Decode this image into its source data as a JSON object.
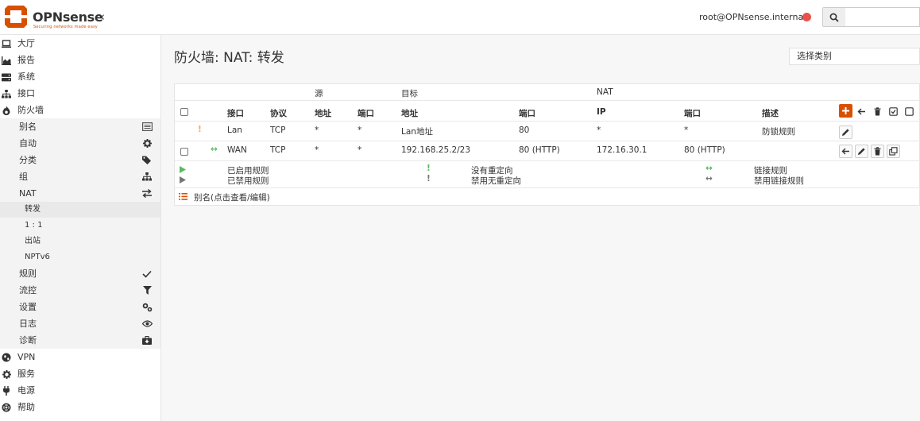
{
  "brand": {
    "name": "OPNsense",
    "tagline": "Securing networks made easy"
  },
  "header": {
    "user": "root@OPNsense.internal",
    "search_placeholder": ""
  },
  "sidebar": {
    "items": [
      {
        "label": "大厅",
        "icon": "laptop-icon"
      },
      {
        "label": "报告",
        "icon": "area-chart-icon"
      },
      {
        "label": "系统",
        "icon": "server-icon"
      },
      {
        "label": "接口",
        "icon": "sitemap-icon"
      },
      {
        "label": "防火墙",
        "icon": "fire-icon"
      }
    ],
    "firewall_sub": [
      {
        "label": "别名",
        "icon": "list-alt-icon"
      },
      {
        "label": "自动",
        "icon": "cog-icon"
      },
      {
        "label": "分类",
        "icon": "tags-icon"
      },
      {
        "label": "组",
        "icon": "sitemap-icon"
      },
      {
        "label": "NAT",
        "icon": "exchange-icon"
      }
    ],
    "nat_sub": [
      {
        "label": "转发"
      },
      {
        "label": "1 : 1"
      },
      {
        "label": "出站"
      },
      {
        "label": "NPTv6"
      }
    ],
    "firewall_sub2": [
      {
        "label": "规则",
        "icon": "check-icon"
      },
      {
        "label": "流控",
        "icon": "filter-icon"
      },
      {
        "label": "设置",
        "icon": "cogs-icon"
      },
      {
        "label": "日志",
        "icon": "eye-icon"
      },
      {
        "label": "诊断",
        "icon": "medkit-icon"
      }
    ],
    "bottom": [
      {
        "label": "VPN",
        "icon": "globe-icon"
      },
      {
        "label": "服务",
        "icon": "cog-icon"
      },
      {
        "label": "电源",
        "icon": "plug-icon"
      },
      {
        "label": "帮助",
        "icon": "support-icon"
      }
    ]
  },
  "page": {
    "title": "防火墙: NAT: 转发",
    "category_placeholder": "选择类别"
  },
  "table": {
    "group_headers": {
      "source": "源",
      "destination": "目标",
      "nat": "NAT"
    },
    "columns": {
      "interface": "接口",
      "protocol": "协议",
      "src_addr": "地址",
      "src_port": "端口",
      "dst_addr": "地址",
      "dst_port": "端口",
      "nat_ip": "IP",
      "nat_port": "端口",
      "description": "描述"
    },
    "rows": [
      {
        "interface": "Lan",
        "protocol": "TCP",
        "src_addr": "*",
        "src_port": "*",
        "dst_addr": "Lan地址",
        "dst_port": "80",
        "nat_ip": "*",
        "nat_port": "*",
        "description": "防锁规则"
      },
      {
        "interface": "WAN",
        "protocol": "TCP",
        "src_addr": "*",
        "src_port": "*",
        "dst_addr": "192.168.25.2/23",
        "dst_port": "80 (HTTP)",
        "nat_ip": "172.16.30.1",
        "nat_port": "80 (HTTP)",
        "description": ""
      }
    ]
  },
  "legend": {
    "enabled_rule": "已启用规则",
    "disabled_rule": "已禁用规则",
    "no_redirect": "没有重定向",
    "disabled_no_redirect": "禁用无重定向",
    "linked_rule": "链接规则",
    "disabled_linked_rule": "禁用链接规则",
    "alias_hint": "别名(点击查看/编辑)"
  },
  "colors": {
    "accent": "#d94f00",
    "status_dot": "#e8524b",
    "green": "#5cb85c",
    "warning": "#f0ad4e"
  }
}
